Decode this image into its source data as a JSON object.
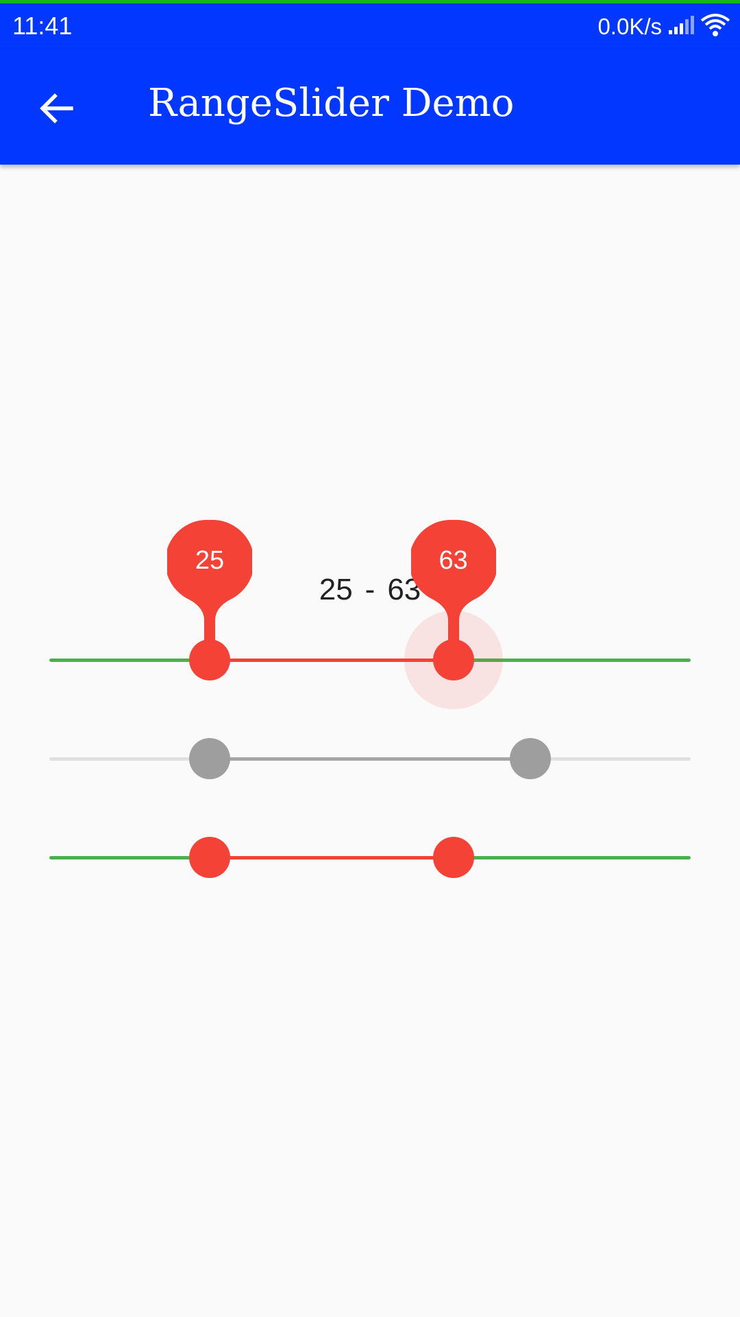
{
  "status_bar": {
    "time": "11:41",
    "net_speed": "0.0K/s",
    "icons": [
      "signal-icon",
      "wifi-icon"
    ]
  },
  "app_bar": {
    "back_icon": "arrow-back-icon",
    "title": "RangeSlider Demo"
  },
  "range_label": {
    "lower": "25",
    "separator": "-",
    "upper": "63"
  },
  "sliders": [
    {
      "name": "range-slider-labeled",
      "min": 0,
      "max": 100,
      "lower": 25,
      "upper": 63,
      "show_value_indicators": true,
      "active_thumb": "upper",
      "inactive_track_color": "#4caf50",
      "active_track_color": "#f44336",
      "thumb_color": "#f44336"
    },
    {
      "name": "range-slider-disabled",
      "min": 0,
      "max": 100,
      "lower": 25,
      "upper": 75,
      "show_value_indicators": false,
      "disabled": true,
      "inactive_track_color": "#e0e0e0",
      "active_track_color": "#a6a6a6",
      "thumb_color": "#9e9e9e"
    },
    {
      "name": "range-slider-plain",
      "min": 0,
      "max": 100,
      "lower": 25,
      "upper": 63,
      "show_value_indicators": false,
      "inactive_track_color": "#4caf50",
      "active_track_color": "#f44336",
      "thumb_color": "#f44336"
    }
  ],
  "colors": {
    "app_bar": "#0137ff",
    "status_accent": "#19b51d",
    "background": "#fafafa"
  }
}
